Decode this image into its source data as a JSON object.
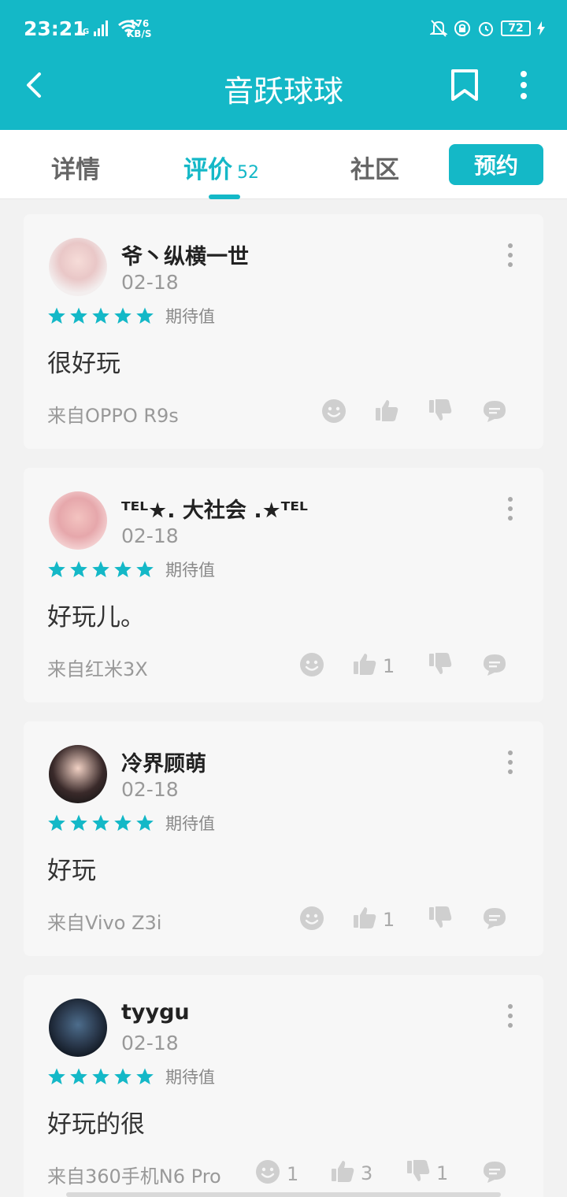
{
  "status": {
    "time": "23:21",
    "network": "4G",
    "speed_value": "176",
    "speed_unit": "KB/S",
    "battery": "72"
  },
  "header": {
    "title": "音跃球球"
  },
  "tabs": [
    {
      "label": "详情"
    },
    {
      "label": "评价",
      "count": "52"
    },
    {
      "label": "社区"
    }
  ],
  "reserve_label": "预约",
  "reviews": [
    {
      "username": "爷丶纵横一世",
      "date": "02-18",
      "rating": 5,
      "rating_label": "期待值",
      "content": "很好玩",
      "source": "来自OPPO R9s",
      "emoji": "",
      "likes": "",
      "dislikes": ""
    },
    {
      "username": "ᵀᴱᴸ★. 大社会 .★ᵀᴱᴸ",
      "date": "02-18",
      "rating": 5,
      "rating_label": "期待值",
      "content": "好玩儿。",
      "source": "来自红米3X",
      "emoji": "",
      "likes": "1",
      "dislikes": ""
    },
    {
      "username": "冷界顾萌",
      "date": "02-18",
      "rating": 5,
      "rating_label": "期待值",
      "content": "好玩",
      "source": "来自Vivo Z3i",
      "emoji": "",
      "likes": "1",
      "dislikes": ""
    },
    {
      "username": "tyygu",
      "date": "02-18",
      "rating": 5,
      "rating_label": "期待值",
      "content": "好玩的很",
      "source": "来自360手机N6 Pro",
      "emoji": "1",
      "likes": "3",
      "dislikes": "1"
    }
  ],
  "colors": {
    "accent": "#14b8c7",
    "card": "#f7f7f7",
    "icon": "#c8c8c8"
  }
}
